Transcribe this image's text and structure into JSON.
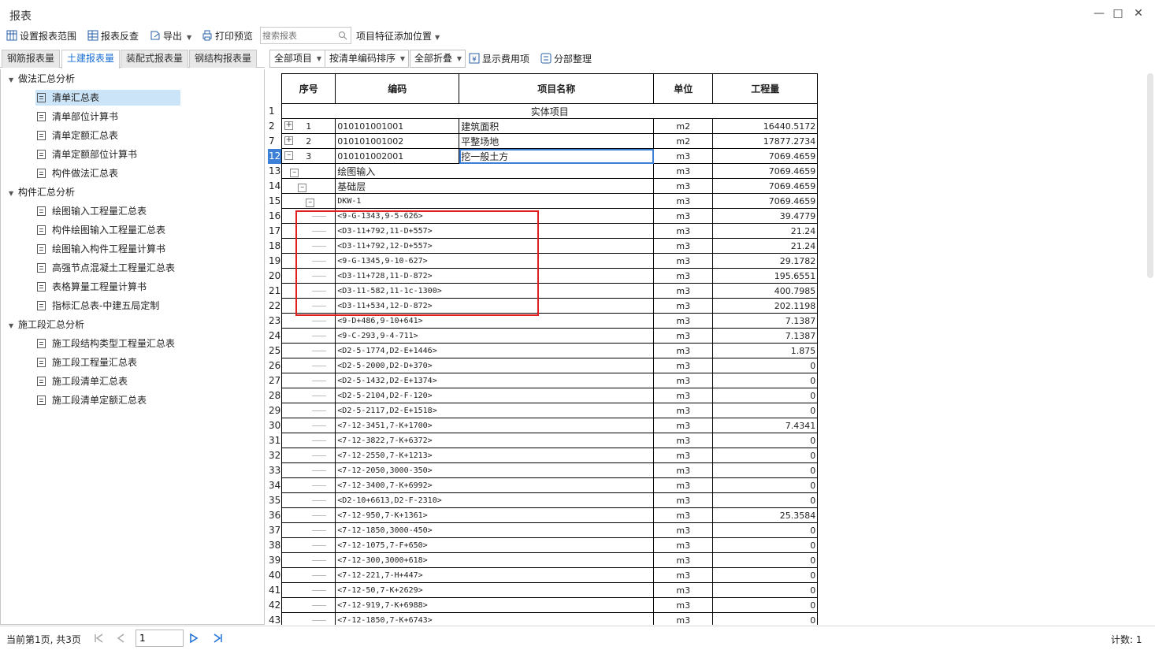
{
  "window": {
    "title": "报表"
  },
  "toolbar": {
    "set_range": "设置报表范围",
    "reverse_check": "报表反查",
    "export": "导出",
    "print_preview": "打印预览",
    "search_placeholder": "搜索报表",
    "feature_position": "项目特征添加位置"
  },
  "tabs": [
    "钢筋报表量",
    "土建报表量",
    "装配式报表量",
    "钢结构报表量"
  ],
  "subtoolbar": {
    "scope": "全部项目",
    "sort": "按清单编码排序",
    "collapse": "全部折叠",
    "show_fee": "显示费用项",
    "section_arrange": "分部整理"
  },
  "tree": [
    {
      "group": "做法汇总分析",
      "items": [
        "清单汇总表",
        "清单部位计算书",
        "清单定额汇总表",
        "清单定额部位计算书",
        "构件做法汇总表"
      ]
    },
    {
      "group": "构件汇总分析",
      "items": [
        "绘图输入工程量汇总表",
        "构件绘图输入工程量汇总表",
        "绘图输入构件工程量计算书",
        "高强节点混凝土工程量汇总表",
        "表格算量工程量计算书",
        "指标汇总表-中建五局定制"
      ]
    },
    {
      "group": "施工段汇总分析",
      "items": [
        "施工段结构类型工程量汇总表",
        "施工段工程量汇总表",
        "施工段清单汇总表",
        "施工段清单定额汇总表"
      ]
    }
  ],
  "grid": {
    "headers": [
      "序号",
      "编码",
      "项目名称",
      "单位",
      "工程量"
    ],
    "section_row": {
      "rownum": "1",
      "label": "实体项目"
    },
    "rows": [
      {
        "rownum": "2",
        "seq": "1",
        "code": "010101001001",
        "name": "建筑面积",
        "unit": "m2",
        "qty": "16440.5172"
      },
      {
        "rownum": "7",
        "seq": "2",
        "code": "010101001002",
        "name": "平整场地",
        "unit": "m2",
        "qty": "17877.2734"
      },
      {
        "rownum": "12",
        "seq": "3",
        "code": "010101002001",
        "name": "挖一般土方",
        "unit": "m3",
        "qty": "7069.4659"
      }
    ],
    "tree_rows": [
      {
        "rownum": "13",
        "label": "绘图输入",
        "unit": "m3",
        "qty": "7069.4659"
      },
      {
        "rownum": "14",
        "label": "基础层",
        "unit": "m3",
        "qty": "7069.4659"
      },
      {
        "rownum": "15",
        "label": "DKW-1",
        "unit": "m3",
        "qty": "7069.4659"
      }
    ],
    "leaf_rows": [
      {
        "rownum": "16",
        "label": "<9-G-1343,9-5-626>",
        "unit": "m3",
        "qty": "39.4779"
      },
      {
        "rownum": "17",
        "label": "<D3-11+792,11-D+557>",
        "unit": "m3",
        "qty": "21.24"
      },
      {
        "rownum": "18",
        "label": "<D3-11+792,12-D+557>",
        "unit": "m3",
        "qty": "21.24"
      },
      {
        "rownum": "19",
        "label": "<9-G-1345,9-10-627>",
        "unit": "m3",
        "qty": "29.1782"
      },
      {
        "rownum": "20",
        "label": "<D3-11+728,11-D-872>",
        "unit": "m3",
        "qty": "195.6551"
      },
      {
        "rownum": "21",
        "label": "<D3-11-582,11-1c-1300>",
        "unit": "m3",
        "qty": "400.7985"
      },
      {
        "rownum": "22",
        "label": "<D3-11+534,12-D-872>",
        "unit": "m3",
        "qty": "202.1198"
      },
      {
        "rownum": "23",
        "label": "<9-D+486,9-10+641>",
        "unit": "m3",
        "qty": "7.1387"
      },
      {
        "rownum": "24",
        "label": "<9-C-293,9-4-711>",
        "unit": "m3",
        "qty": "7.1387"
      },
      {
        "rownum": "25",
        "label": "<D2-5-1774,D2-E+1446>",
        "unit": "m3",
        "qty": "1.875"
      },
      {
        "rownum": "26",
        "label": "<D2-5-2000,D2-D+370>",
        "unit": "m3",
        "qty": "0"
      },
      {
        "rownum": "27",
        "label": "<D2-5-1432,D2-E+1374>",
        "unit": "m3",
        "qty": "0"
      },
      {
        "rownum": "28",
        "label": "<D2-5-2104,D2-F-120>",
        "unit": "m3",
        "qty": "0"
      },
      {
        "rownum": "29",
        "label": "<D2-5-2117,D2-E+1518>",
        "unit": "m3",
        "qty": "0"
      },
      {
        "rownum": "30",
        "label": "<7-12-3451,7-K+1700>",
        "unit": "m3",
        "qty": "7.4341"
      },
      {
        "rownum": "31",
        "label": "<7-12-3822,7-K+6372>",
        "unit": "m3",
        "qty": "0"
      },
      {
        "rownum": "32",
        "label": "<7-12-2550,7-K+1213>",
        "unit": "m3",
        "qty": "0"
      },
      {
        "rownum": "33",
        "label": "<7-12-2050,3000-350>",
        "unit": "m3",
        "qty": "0"
      },
      {
        "rownum": "34",
        "label": "<7-12-3400,7-K+6992>",
        "unit": "m3",
        "qty": "0"
      },
      {
        "rownum": "35",
        "label": "<D2-10+6613,D2-F-2310>",
        "unit": "m3",
        "qty": "0"
      },
      {
        "rownum": "36",
        "label": "<7-12-950,7-K+1361>",
        "unit": "m3",
        "qty": "25.3584"
      },
      {
        "rownum": "37",
        "label": "<7-12-1850,3000-450>",
        "unit": "m3",
        "qty": "0"
      },
      {
        "rownum": "38",
        "label": "<7-12-1075,7-F+650>",
        "unit": "m3",
        "qty": "0"
      },
      {
        "rownum": "39",
        "label": "<7-12-300,3000+618>",
        "unit": "m3",
        "qty": "0"
      },
      {
        "rownum": "40",
        "label": "<7-12-221,7-H+447>",
        "unit": "m3",
        "qty": "0"
      },
      {
        "rownum": "41",
        "label": "<7-12-50,7-K+2629>",
        "unit": "m3",
        "qty": "0"
      },
      {
        "rownum": "42",
        "label": "<7-12-919,7-K+6988>",
        "unit": "m3",
        "qty": "0"
      },
      {
        "rownum": "43",
        "label": "<7-12-1850,7-K+6743>",
        "unit": "m3",
        "qty": "0"
      }
    ]
  },
  "status": {
    "page_info": "当前第1页, 共3页",
    "page_value": "1",
    "count": "计数: 1"
  },
  "colors": {
    "accent": "#1a6fd6",
    "selection": "#cce4f7",
    "highlight_box": "#e02020"
  },
  "icons": [
    "set-range-icon",
    "reverse-check-icon",
    "export-icon",
    "print-preview-icon",
    "search-icon",
    "show-fee-icon",
    "section-arrange-icon"
  ]
}
